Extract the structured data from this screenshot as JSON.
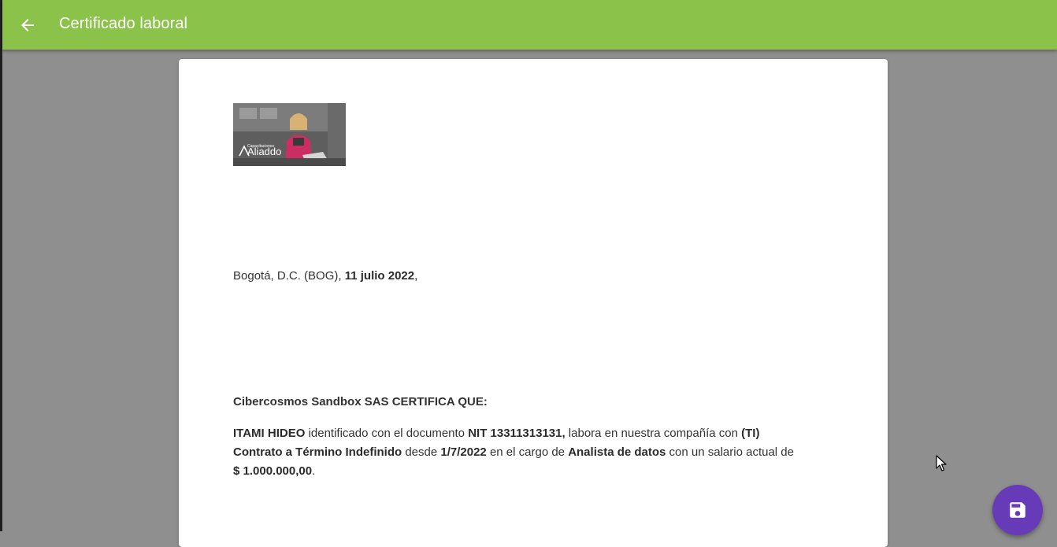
{
  "app_bar": {
    "title": "Certificado laboral",
    "back_icon": "arrow-back-icon",
    "color": "#8bc34a"
  },
  "document": {
    "logo": {
      "small_text": "Capacitaciones",
      "brand_text": "Aliaddo"
    },
    "place_prefix": "Bogotá, D.C. (BOG), ",
    "date": "11 julio 2022",
    "place_suffix": ",",
    "heading": "Cibercosmos Sandbox SAS CERTIFICA QUE:",
    "employee_name": "ITAMI HIDEO",
    "t1": " identificado con el documento ",
    "document_id": "NIT 13311313131,",
    "t2": " labora en nuestra compañía con ",
    "contract_code": "(TI)",
    "contract_type": "Contrato a Término Indefinido",
    "t3": " desde ",
    "start_date": "1/7/2022",
    "t4": " en el cargo de ",
    "position": "Analista de datos",
    "t5": " con un salario actual de ",
    "salary": "$ 1.000.000,00",
    "t6": "."
  },
  "fab": {
    "icon": "save-icon",
    "color": "#673ab7"
  }
}
